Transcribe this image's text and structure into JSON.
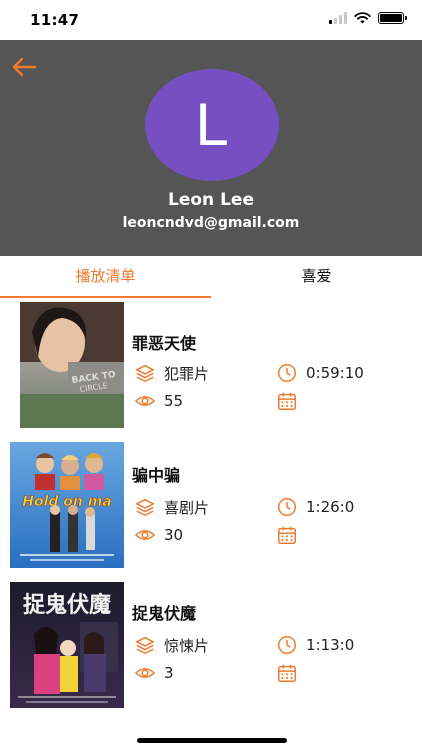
{
  "status_bar": {
    "time": "11:47"
  },
  "header": {
    "avatar_letter": "L",
    "name": "Leon Lee",
    "email": "leoncndvd@gmail.com"
  },
  "tabs": [
    {
      "label": "播放清单",
      "active": true
    },
    {
      "label": "喜爱",
      "active": false
    }
  ],
  "movies": [
    {
      "title": "罪恶天使",
      "genre": "犯罪片",
      "duration": "0:59:10",
      "views": "55",
      "poster_text": "BACK TO CIRCLE"
    },
    {
      "title": "骗中骗",
      "genre": "喜剧片",
      "duration": "1:26:0",
      "views": "30",
      "poster_text": "Hold on ma"
    },
    {
      "title": "捉鬼伏魔",
      "genre": "惊悚片",
      "duration": "1:13:0",
      "views": "3",
      "poster_text": "捉鬼伏魔"
    }
  ],
  "colors": {
    "accent": "#ef7a2f",
    "header_bg": "#555555",
    "avatar_bg": "#7650c2"
  },
  "icons": {
    "genre": "layers-icon",
    "duration": "clock-icon",
    "views": "eye-icon",
    "date": "calendar-icon",
    "back": "arrow-left-icon"
  }
}
